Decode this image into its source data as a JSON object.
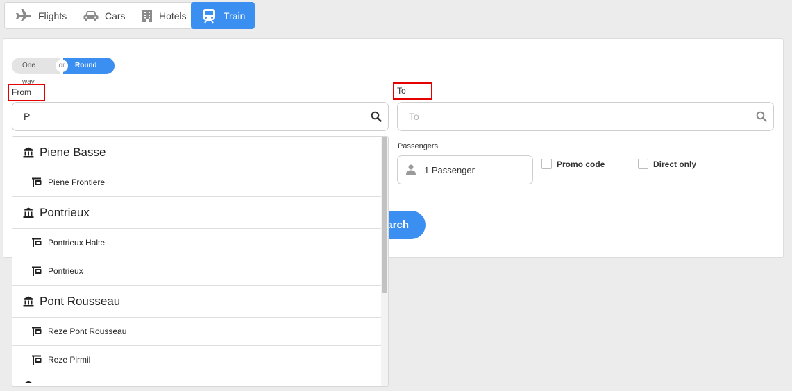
{
  "tabs": [
    {
      "label": "Flights",
      "icon": "plane-icon"
    },
    {
      "label": "Cars",
      "icon": "car-icon"
    },
    {
      "label": "Hotels",
      "icon": "building-icon"
    },
    {
      "label": "Train",
      "icon": "train-icon",
      "active": true
    }
  ],
  "trip": {
    "one_way": "One way",
    "or": "or",
    "round_trip": "Round trip",
    "selected": "Round trip"
  },
  "from": {
    "label": "From",
    "value": "P"
  },
  "to": {
    "label": "To",
    "placeholder": "To"
  },
  "passengers": {
    "label": "Passengers",
    "value": "1 Passenger"
  },
  "options": {
    "promo": "Promo code",
    "direct": "Direct only"
  },
  "search_button": {
    "label": "Search",
    "visible_text": "arch"
  },
  "suggestions": [
    {
      "type": "city",
      "label": "Piene Basse"
    },
    {
      "type": "station",
      "label": "Piene Frontiere"
    },
    {
      "type": "city",
      "label": "Pontrieux"
    },
    {
      "type": "station",
      "label": "Pontrieux Halte"
    },
    {
      "type": "station",
      "label": "Pontrieux"
    },
    {
      "type": "city",
      "label": "Pont Rousseau"
    },
    {
      "type": "station",
      "label": "Reze Pont Rousseau"
    },
    {
      "type": "station",
      "label": "Reze Pirmil"
    }
  ],
  "colors": {
    "accent": "#3b8ff0",
    "highlight_border": "#e60000"
  }
}
